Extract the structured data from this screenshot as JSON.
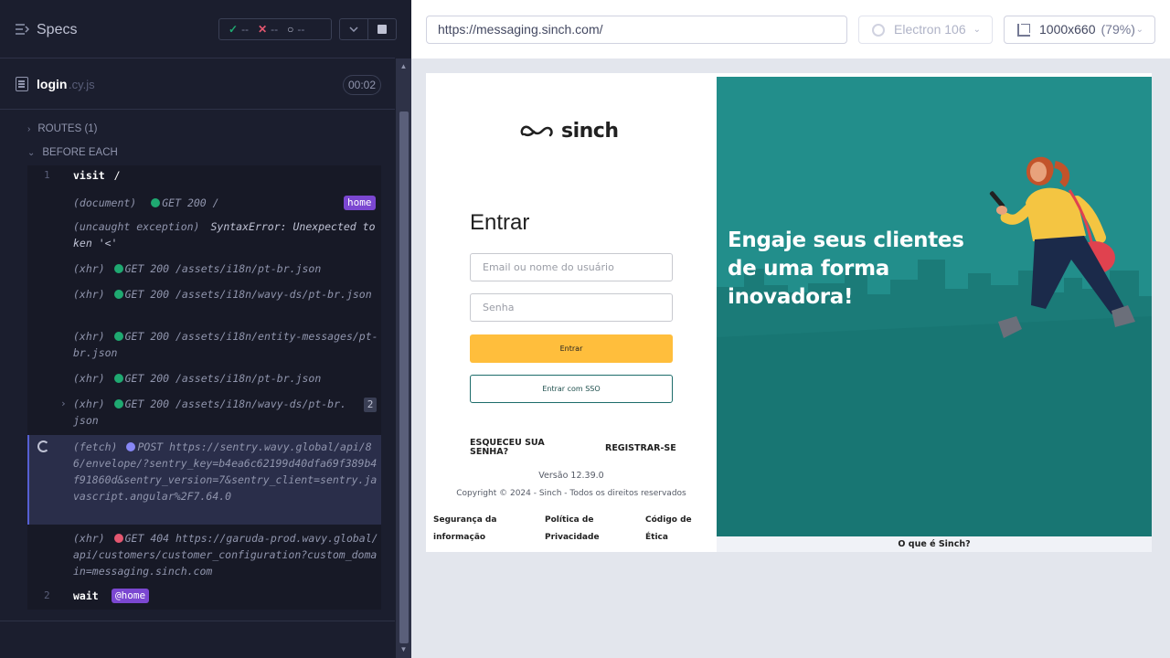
{
  "reporter": {
    "specs_label": "Specs",
    "stats": {
      "passed": "--",
      "failed": "--",
      "pending": "--"
    },
    "spec_file": {
      "name": "login",
      "ext": ".cy.js",
      "duration": "00:02"
    },
    "hooks": [
      {
        "label": "ROUTES (1)",
        "expanded": false
      },
      {
        "label": "BEFORE EACH",
        "expanded": true
      }
    ],
    "commands": [
      {
        "num": "1",
        "name": "visit",
        "message": "/"
      },
      {
        "type": "(document)",
        "status_color": "green",
        "message": "GET 200 /",
        "alias": "home"
      },
      {
        "type": "(uncaught exception)",
        "message": "SyntaxError: Unexpected token '<'"
      },
      {
        "type": "(xhr)",
        "status_color": "green",
        "message": "GET 200 /assets/i18n/pt-br.json"
      },
      {
        "type": "(xhr)",
        "status_color": "green",
        "message": "GET 200 /assets/i18n/wavy-ds/pt-br.json"
      },
      {
        "type": "(xhr)",
        "status_color": "green",
        "message": "GET 200 /assets/i18n/entity-messages/pt-br.json"
      },
      {
        "type": "(xhr)",
        "status_color": "green",
        "message": "GET 200 /assets/i18n/pt-br.json"
      },
      {
        "type": "(xhr)",
        "status_color": "green",
        "message": "GET 200 /assets/i18n/wavy-ds/pt-br.json",
        "count": "2"
      },
      {
        "type": "(fetch)",
        "status_color": "purple",
        "message": "POST https://sentry.wavy.global/api/86/envelope/?sentry_key=b4ea6c62199d40dfa69f389b4f91860d&sentry_version=7&sentry_client=sentry.javascript.angular%2F7.64.0",
        "pending": true
      },
      {
        "type": "(xhr)",
        "status_color": "red",
        "message": "GET 404 https://garuda-prod.wavy.global/api/customers/customer_configuration?custom_domain=messaging.sinch.com"
      },
      {
        "num": "2",
        "name": "wait",
        "alias": "@home"
      }
    ]
  },
  "aut_header": {
    "url": "https://messaging.sinch.com/",
    "browser": "Electron 106",
    "viewport": "1000x660",
    "zoom": "(79%)"
  },
  "app": {
    "logo_text": "sinch",
    "title": "Entrar",
    "email_placeholder": "Email ou nome do usuário",
    "password_placeholder": "Senha",
    "login_button": "Entrar",
    "sso_button": "Entrar com SSO",
    "forgot_password": "ESQUECEU SUA SENHA?",
    "register": "REGISTRAR-SE",
    "version": "Versão 12.39.0",
    "copyright": "Copyright © 2024 - Sinch - Todos os direitos reservados",
    "footer_links": [
      "Segurança da informação",
      "Política de Privacidade",
      "Código de Ética"
    ],
    "hero_title": "Engaje seus clientes de uma forma inovadora!",
    "hero_footer_link": "O que é Sinch?"
  },
  "colors": {
    "reporter_bg": "#1b1e2e",
    "pass": "#1fa971",
    "fail": "#e45770",
    "pending": "#8787f5",
    "alias": "#7b47d1",
    "sinch_teal": "#228e8b",
    "sinch_yellow": "#ffbe3c"
  }
}
